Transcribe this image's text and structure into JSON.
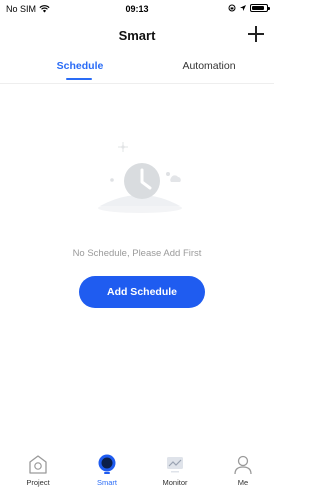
{
  "status_bar": {
    "carrier": "No SIM",
    "time": "09:13",
    "icons": [
      "wifi-icon",
      "location-icon",
      "battery-icon"
    ]
  },
  "header": {
    "title": "Smart",
    "add_icon": "plus-icon"
  },
  "tabs": [
    {
      "label": "Schedule",
      "active": true
    },
    {
      "label": "Automation",
      "active": false
    }
  ],
  "empty_state": {
    "illustration": "clock-icon",
    "message": "No Schedule, Please Add First",
    "button_label": "Add Schedule"
  },
  "bottom_nav": [
    {
      "label": "Project",
      "icon": "home-icon",
      "active": false
    },
    {
      "label": "Smart",
      "icon": "smart-icon",
      "active": true
    },
    {
      "label": "Monitor",
      "icon": "monitor-icon",
      "active": false
    },
    {
      "label": "Me",
      "icon": "user-icon",
      "active": false
    }
  ],
  "colors": {
    "accent": "#2a6cf6",
    "button": "#1f5cf0",
    "muted_text": "#9a9a9a"
  }
}
